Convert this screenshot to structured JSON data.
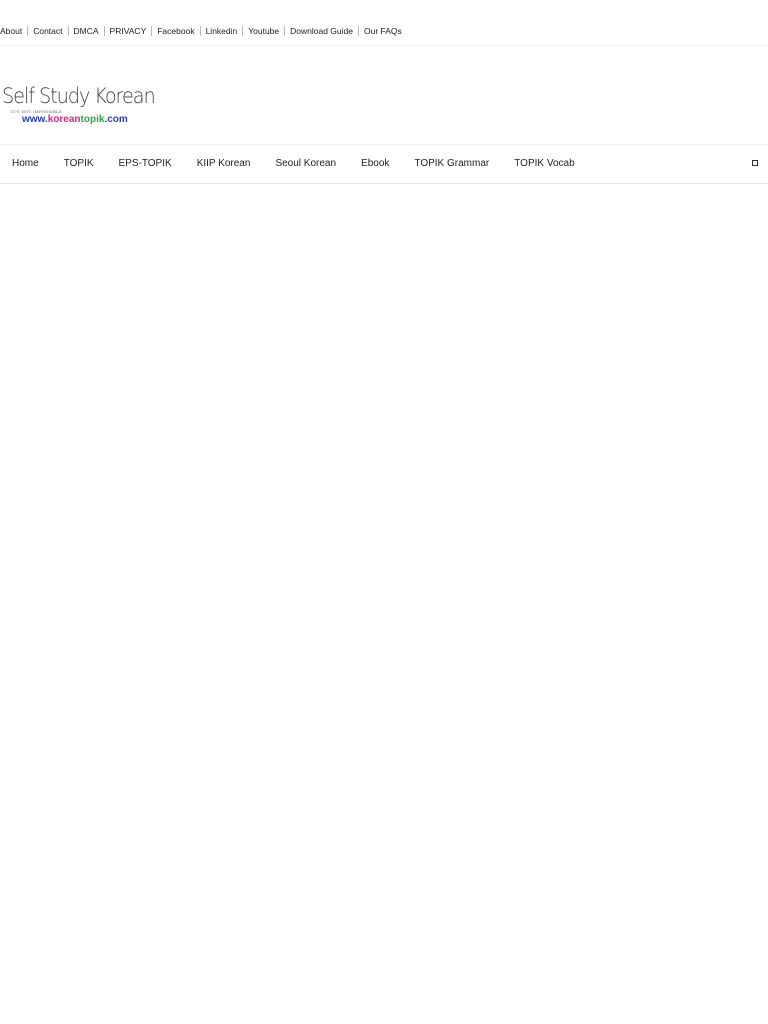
{
  "top_bar": {
    "links": [
      {
        "label": "About"
      },
      {
        "label": "Contact"
      },
      {
        "label": "DMCA"
      },
      {
        "label": "PRIVACY"
      },
      {
        "label": "Facebook"
      },
      {
        "label": "Linkedin"
      },
      {
        "label": "Youtube"
      },
      {
        "label": "Download Guide"
      },
      {
        "label": "Our FAQs"
      }
    ]
  },
  "logo": {
    "title": "Self Study Korean",
    "tagline": "IT'S NOT IMPOSSIBLE",
    "url_parts": {
      "prefix": "www.",
      "korean": "korean",
      "topik": "topik",
      "suffix": ".com"
    }
  },
  "colors": {
    "url_prefix": "#2b3fb7",
    "url_korean": "#e0218a",
    "url_topik": "#29a84a",
    "url_suffix": "#2b3fb7"
  },
  "nav": {
    "items": [
      {
        "label": "Home"
      },
      {
        "label": "TOPIK"
      },
      {
        "label": "EPS-TOPIK"
      },
      {
        "label": "KIIP Korean"
      },
      {
        "label": "Seoul Korean"
      },
      {
        "label": "Ebook"
      },
      {
        "label": "TOPIK Grammar"
      },
      {
        "label": "TOPIK Vocab"
      }
    ],
    "search_icon": "search-toggle-icon"
  }
}
